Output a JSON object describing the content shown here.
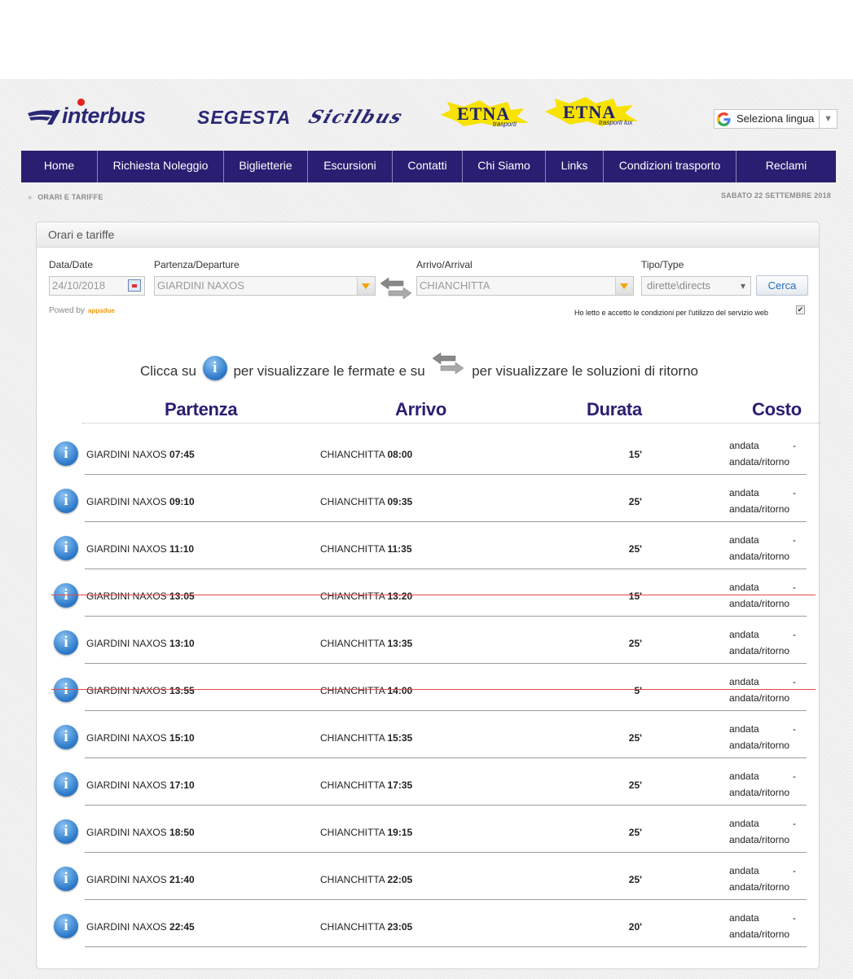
{
  "header": {
    "logos": [
      {
        "name": "interbus",
        "text": "interbus"
      },
      {
        "name": "segesta",
        "text": "SEGESTA"
      },
      {
        "name": "sicilbus",
        "text": "Sicilbus"
      },
      {
        "name": "etna-trasporti",
        "text": "ETNA",
        "sub": "trasporti"
      },
      {
        "name": "etna-trasporti-lux",
        "text": "ETNA",
        "sub": "trasporti lux"
      }
    ],
    "language_select": "Seleziona lingua"
  },
  "nav": [
    "Home",
    "Richiesta Noleggio",
    "Biglietterie",
    "Escursioni",
    "Contatti",
    "Chi Siamo",
    "Links",
    "Condizioni trasporto",
    "Reclami"
  ],
  "breadcrumb": "ORARI E TARIFFE",
  "current_date": "SABATO 22 SETTEMBRE 2018",
  "panel": {
    "title": "Orari e tariffe",
    "form": {
      "date_label": "Data/Date",
      "date_value": "24/10/2018",
      "departure_label": "Partenza/Departure",
      "departure_value": "GIARDINI NAXOS",
      "arrival_label": "Arrivo/Arrival",
      "arrival_value": "CHIANCHITTA",
      "type_label": "Tipo/Type",
      "type_value": "dirette\\directs",
      "search_button": "Cerca",
      "powered_by": "Powed by",
      "powered_brand": "appadue",
      "terms_text": "Ho letto e accetto le condizioni per l'utilizzo del servizio web",
      "terms_checked": true
    },
    "hint": {
      "part1": "Clicca su",
      "part2": "per visualizzare le fermate e su",
      "part3": "per visualizzare le soluzioni di ritorno"
    },
    "columns": {
      "departure": "Partenza",
      "arrival": "Arrivo",
      "duration": "Durata",
      "cost": "Costo"
    },
    "rows": [
      {
        "from": "GIARDINI NAXOS",
        "dep": "07:45",
        "to": "CHIANCHITTA",
        "arr": "08:00",
        "duration": "15'",
        "cost1": "andata",
        "dash": "-",
        "cost2": "andata/ritorno",
        "struck": false
      },
      {
        "from": "GIARDINI NAXOS",
        "dep": "09:10",
        "to": "CHIANCHITTA",
        "arr": "09:35",
        "duration": "25'",
        "cost1": "andata",
        "dash": "-",
        "cost2": "andata/ritorno",
        "struck": false
      },
      {
        "from": "GIARDINI NAXOS",
        "dep": "11:10",
        "to": "CHIANCHITTA",
        "arr": "11:35",
        "duration": "25'",
        "cost1": "andata",
        "dash": "-",
        "cost2": "andata/ritorno",
        "struck": false
      },
      {
        "from": "GIARDINI NAXOS",
        "dep": "13:05",
        "to": "CHIANCHITTA",
        "arr": "13:20",
        "duration": "15'",
        "cost1": "andata",
        "dash": "-",
        "cost2": "andata/ritorno",
        "struck": true
      },
      {
        "from": "GIARDINI NAXOS",
        "dep": "13:10",
        "to": "CHIANCHITTA",
        "arr": "13:35",
        "duration": "25'",
        "cost1": "andata",
        "dash": "-",
        "cost2": "andata/ritorno",
        "struck": false
      },
      {
        "from": "GIARDINI NAXOS",
        "dep": "13:55",
        "to": "CHIANCHITTA",
        "arr": "14:00",
        "duration": "5'",
        "cost1": "andata",
        "dash": "-",
        "cost2": "andata/ritorno",
        "struck": true
      },
      {
        "from": "GIARDINI NAXOS",
        "dep": "15:10",
        "to": "CHIANCHITTA",
        "arr": "15:35",
        "duration": "25'",
        "cost1": "andata",
        "dash": "-",
        "cost2": "andata/ritorno",
        "struck": false
      },
      {
        "from": "GIARDINI NAXOS",
        "dep": "17:10",
        "to": "CHIANCHITTA",
        "arr": "17:35",
        "duration": "25'",
        "cost1": "andata",
        "dash": "-",
        "cost2": "andata/ritorno",
        "struck": false
      },
      {
        "from": "GIARDINI NAXOS",
        "dep": "18:50",
        "to": "CHIANCHITTA",
        "arr": "19:15",
        "duration": "25'",
        "cost1": "andata",
        "dash": "-",
        "cost2": "andata/ritorno",
        "struck": false
      },
      {
        "from": "GIARDINI NAXOS",
        "dep": "21:40",
        "to": "CHIANCHITTA",
        "arr": "22:05",
        "duration": "25'",
        "cost1": "andata",
        "dash": "-",
        "cost2": "andata/ritorno",
        "struck": false
      },
      {
        "from": "GIARDINI NAXOS",
        "dep": "22:45",
        "to": "CHIANCHITTA",
        "arr": "23:05",
        "duration": "20'",
        "cost1": "andata",
        "dash": "-",
        "cost2": "andata/ritorno",
        "struck": false
      }
    ]
  },
  "colors": {
    "nav_bg": "#2a1e72",
    "heading": "#2a1e72",
    "strike": "#e8474a",
    "dropdown_arrow": "#f3a400",
    "info_icon": "#2f7ccb"
  },
  "icons": {
    "info": "info-icon",
    "swap": "swap-arrows-icon",
    "calendar": "calendar-icon",
    "google": "google-g-icon"
  }
}
